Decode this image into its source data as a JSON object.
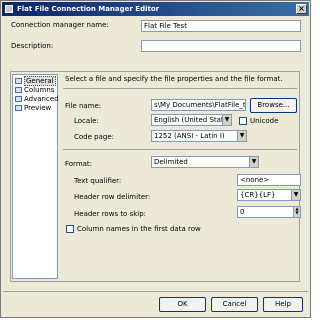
{
  "window": {
    "title": "Flat File Connection Manager Editor",
    "close_symbol": "×"
  },
  "form": {
    "name_label": "Connection manager name:",
    "name_value": "Flat File Test",
    "desc_label": "Description:",
    "desc_value": ""
  },
  "nav": {
    "items": [
      "General",
      "Columns",
      "Advanced",
      "Preview"
    ],
    "selected": "General"
  },
  "general": {
    "intro": "Select a file and specify the file properties and the file format.",
    "file_label": "File name:",
    "file_value": "s\\My Documents\\FlatFile_test.txt",
    "browse": "Browse...",
    "locale_label": "Locale:",
    "locale_value": "English (United States)",
    "unicode_label": "Unicode",
    "codepage_label": "Code page:",
    "codepage_value": "1252  (ANSI - Latin I)",
    "format_label": "Format:",
    "format_value": "Delimited",
    "textq_label": "Text qualifier:",
    "textq_value": "<none>",
    "hdrdelim_label": "Header row delimiter:",
    "hdrdelim_value": "{CR}{LF}",
    "hdrskip_label": "Header rows to skip:",
    "hdrskip_value": "0",
    "colnames_label": "Column names in the first data row"
  },
  "buttons": {
    "ok": "OK",
    "cancel": "Cancel",
    "help": "Help"
  }
}
